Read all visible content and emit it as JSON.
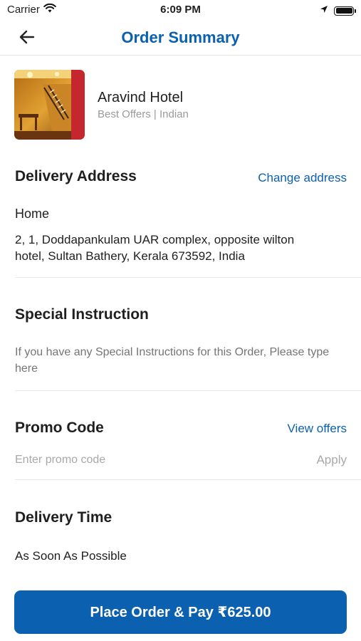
{
  "status_bar": {
    "carrier": "Carrier",
    "time": "6:09 PM"
  },
  "nav": {
    "title": "Order Summary",
    "back_icon": "arrow-left-icon"
  },
  "restaurant": {
    "name": "Aravind Hotel",
    "meta": "Best Offers | Indian"
  },
  "delivery_address": {
    "title": "Delivery Address",
    "change_label": "Change address",
    "label": "Home",
    "line1": "2, 1, Doddapankulam UAR complex, opposite wilton",
    "line2": "hotel, Sultan Bathery, Kerala 673592, India"
  },
  "special_instruction": {
    "title": "Special Instruction",
    "placeholder": "If you have any Special Instructions for this Order, Please type here"
  },
  "promo": {
    "title": "Promo Code",
    "view_offers_label": "View offers",
    "placeholder": "Enter promo code",
    "apply_label": "Apply"
  },
  "delivery_time": {
    "title": "Delivery Time",
    "value": "As Soon As Possible"
  },
  "place_order": {
    "label": "Place Order & Pay ₹625.00"
  },
  "colors": {
    "accent": "#0b60b0",
    "muted": "#9a9a9a",
    "divider": "#e8e8e8"
  }
}
